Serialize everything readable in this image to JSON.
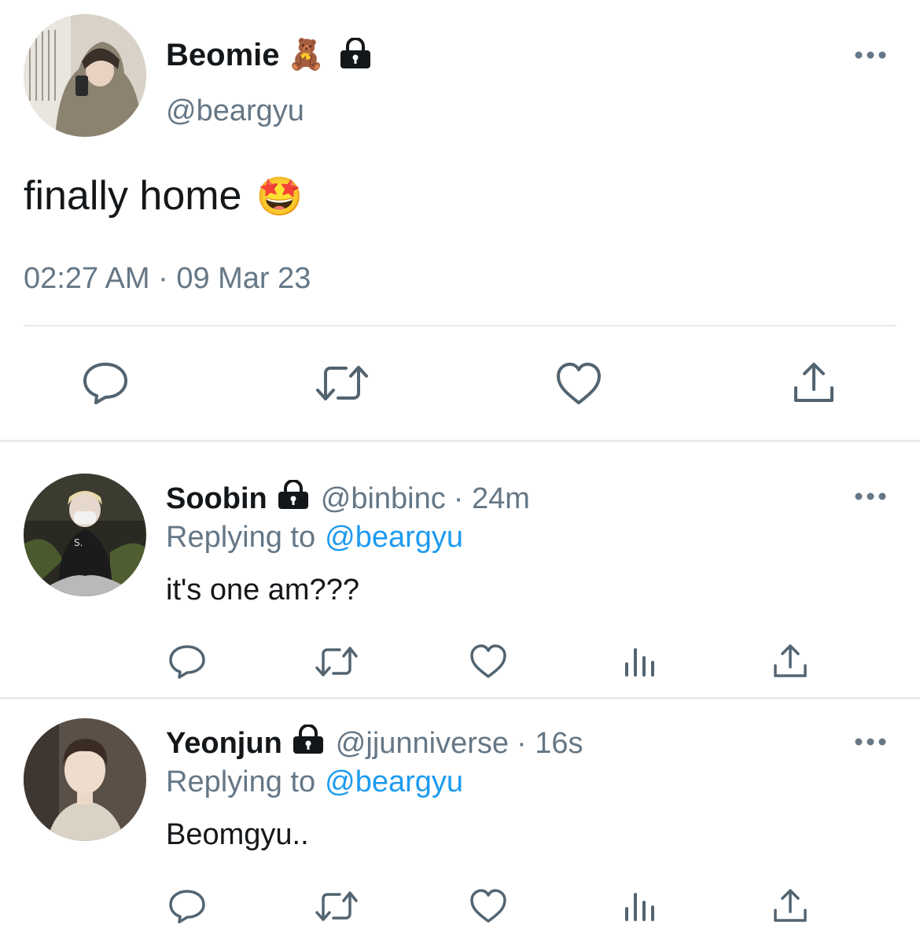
{
  "main_tweet": {
    "display_name": "Beomie",
    "name_emoji": "🧸",
    "handle": "@beargyu",
    "text": "finally home",
    "text_emoji": "🤩",
    "timestamp": "02:27 AM · 09 Mar 23"
  },
  "replies": [
    {
      "display_name": "Soobin",
      "handle": "@binbinc",
      "time": "· 24m",
      "replying_label": "Replying to",
      "replying_to": "@beargyu",
      "text": "it's one am???"
    },
    {
      "display_name": "Yeonjun",
      "handle": "@jjunniverse",
      "time": "· 16s",
      "replying_label": "Replying to",
      "replying_to": "@beargyu",
      "text": "Beomgyu.."
    }
  ],
  "colors": {
    "text": "#14171a",
    "secondary": "#657786",
    "link": "#1d9bf0",
    "icon": "#536471",
    "divider": "#e6ecf0"
  }
}
